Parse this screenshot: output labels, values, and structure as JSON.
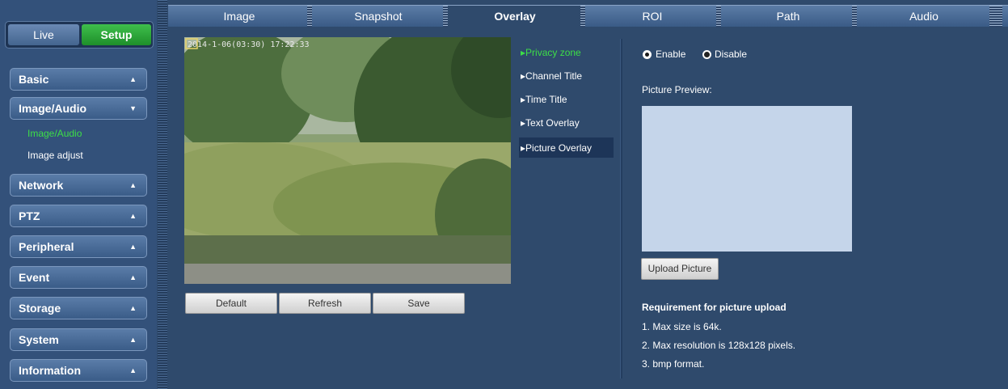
{
  "mode_switch": {
    "live": "Live",
    "setup": "Setup"
  },
  "sidebar": {
    "menus": [
      {
        "label": "Basic",
        "arrow": "▲"
      },
      {
        "label": "Image/Audio",
        "arrow": "▼"
      },
      {
        "label": "Network",
        "arrow": "▲"
      },
      {
        "label": "PTZ",
        "arrow": "▲"
      },
      {
        "label": "Peripheral",
        "arrow": "▲"
      },
      {
        "label": "Event",
        "arrow": "▲"
      },
      {
        "label": "Storage",
        "arrow": "▲"
      },
      {
        "label": "System",
        "arrow": "▲"
      },
      {
        "label": "Information",
        "arrow": "▲"
      }
    ],
    "submenu": [
      {
        "label": "Image/Audio",
        "active": true
      },
      {
        "label": "Image adjust",
        "active": false
      }
    ]
  },
  "tabs": [
    {
      "label": "Image"
    },
    {
      "label": "Snapshot"
    },
    {
      "label": "Overlay",
      "active": true
    },
    {
      "label": "ROI"
    },
    {
      "label": "Path"
    },
    {
      "label": "Audio"
    }
  ],
  "video": {
    "timestamp": "2014-1-06(03:30) 17:22:33"
  },
  "actions": {
    "default": "Default",
    "refresh": "Refresh",
    "save": "Save"
  },
  "overlay_menu": [
    {
      "label": "▸Privacy zone"
    },
    {
      "label": "▸Channel Title"
    },
    {
      "label": "▸Time Title"
    },
    {
      "label": "▸Text Overlay"
    },
    {
      "label": "▸Picture Overlay",
      "selected": true
    }
  ],
  "settings": {
    "enable_label": "Enable",
    "disable_label": "Disable",
    "selected": "Disable",
    "preview_label": "Picture Preview:",
    "upload_label": "Upload Picture",
    "requirement_title": "Requirement for picture upload",
    "requirements": [
      "1. Max size is 64k.",
      "2. Max resolution is 128x128 pixels.",
      "3. bmp format."
    ]
  },
  "colors": {
    "active_green": "#3ddf47",
    "background": "#2f4a6c",
    "preview": "#c5d5ea"
  }
}
